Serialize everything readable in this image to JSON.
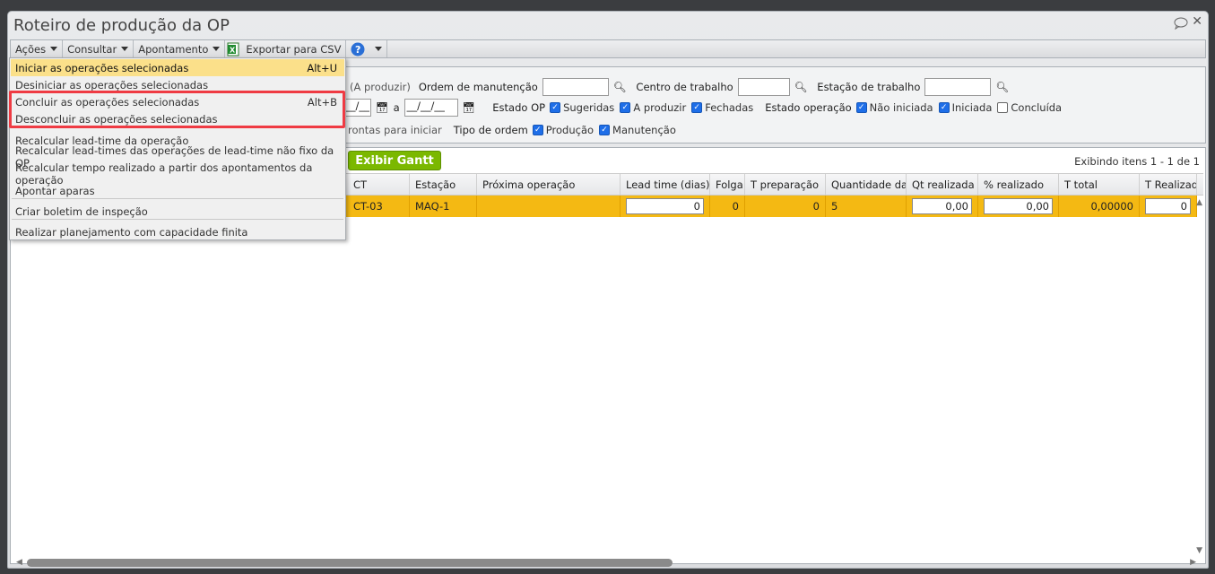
{
  "window": {
    "title": "Roteiro de produção da OP"
  },
  "toolbar": {
    "acoes": "Ações",
    "consultar": "Consultar",
    "apontamento": "Apontamento",
    "exportar": "Exportar para CSV"
  },
  "filters": {
    "partial_label": "da (A produzir)",
    "ordem_manutencao": "Ordem de manutenção",
    "centro_trabalho": "Centro de trabalho",
    "estacao_trabalho": "Estação de trabalho",
    "date_from": "__/__",
    "date_sep": "a",
    "date_to": "__/__/__",
    "estado_op": "Estado OP",
    "estado_op_options": [
      {
        "label": "Sugeridas",
        "checked": true
      },
      {
        "label": "A produzir",
        "checked": true
      },
      {
        "label": "Fechadas",
        "checked": true
      }
    ],
    "estado_operacao": "Estado operação",
    "estado_operacao_options": [
      {
        "label": "Não iniciada",
        "checked": true
      },
      {
        "label": "Iniciada",
        "checked": true
      },
      {
        "label": "Concluída",
        "checked": false
      }
    ],
    "partial_label2": "rontas para iniciar",
    "tipo_ordem": "Tipo de ordem",
    "tipo_ordem_options": [
      {
        "label": "Produção",
        "checked": true
      },
      {
        "label": "Manutenção",
        "checked": true
      }
    ]
  },
  "grid": {
    "gantt_button": "Exibir Gantt",
    "paging": "Exibindo itens 1 - 1 de 1",
    "columns": [
      "CT",
      "Estação",
      "Próxima operação",
      "Lead time (dias)",
      "Folga",
      "T preparação",
      "Quantidade da",
      "Qt realizada",
      "% realizado",
      "T total",
      "T Realizado"
    ],
    "rows": [
      [
        "CT-03",
        "MAQ-1",
        "",
        "0",
        "0",
        "0",
        "5",
        "0,00",
        "0,00",
        "0,00000",
        "0"
      ]
    ]
  },
  "menu": {
    "items": [
      {
        "label": "Iniciar as operações selecionadas",
        "shortcut": "Alt+U"
      },
      {
        "label": "Desiniciar as operações selecionadas",
        "shortcut": ""
      },
      {
        "label": "Concluir as operações selecionadas",
        "shortcut": "Alt+B"
      },
      {
        "label": "Desconcluir as operações selecionadas",
        "shortcut": ""
      },
      {
        "label": "Recalcular lead-time da operação",
        "shortcut": ""
      },
      {
        "label": "Recalcular lead-times das operações de lead-time não fixo da OP",
        "shortcut": ""
      },
      {
        "label": "Recalcular tempo realizado a partir dos apontamentos da operação",
        "shortcut": ""
      },
      {
        "label": "Apontar aparas",
        "shortcut": ""
      },
      {
        "label": "Criar boletim de inspeção",
        "shortcut": ""
      },
      {
        "label": "Realizar planejamento com capacidade finita",
        "shortcut": ""
      }
    ]
  },
  "colors": {
    "highlight_row": "#f4b913",
    "gantt": "#7bb800",
    "menu_hover": "#fbe08a",
    "annotation": "#ef3b43"
  }
}
